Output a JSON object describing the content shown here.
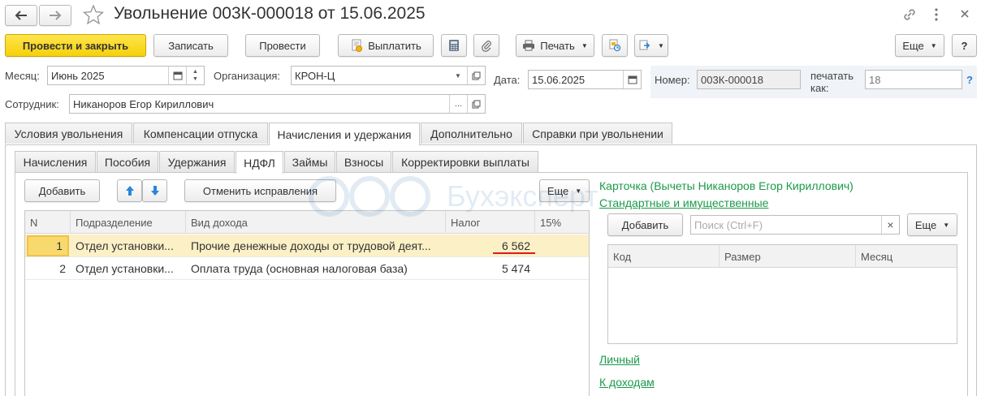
{
  "window": {
    "title": "Увольнение 003К-000018 от 15.06.2025"
  },
  "toolbar": {
    "post_close": "Провести и закрыть",
    "save": "Записать",
    "post": "Провести",
    "pay": "Выплатить",
    "print": "Печать",
    "more": "Еще",
    "help": "?"
  },
  "form": {
    "month_label": "Месяц:",
    "month_value": "Июнь 2025",
    "org_label": "Организация:",
    "org_value": "КРОН-Ц",
    "date_label": "Дата:",
    "date_value": "15.06.2025",
    "number_label": "Номер:",
    "number_value": "003К-000018",
    "print_as_label_1": "печатать",
    "print_as_label_2": "как:",
    "print_as_placeholder": "18",
    "employee_label": "Сотрудник:",
    "employee_value": "Никаноров Егор Кириллович",
    "help_q": "?"
  },
  "tabs": [
    {
      "label": "Условия увольнения"
    },
    {
      "label": "Компенсации отпуска"
    },
    {
      "label": "Начисления и удержания"
    },
    {
      "label": "Дополнительно"
    },
    {
      "label": "Справки при увольнении"
    }
  ],
  "subtabs": [
    {
      "label": "Начисления"
    },
    {
      "label": "Пособия"
    },
    {
      "label": "Удержания"
    },
    {
      "label": "НДФЛ"
    },
    {
      "label": "Займы"
    },
    {
      "label": "Взносы"
    },
    {
      "label": "Корректировки выплаты"
    }
  ],
  "ndfl": {
    "add": "Добавить",
    "cancel_corrections": "Отменить исправления",
    "more": "Еще",
    "columns": [
      "N",
      "Подразделение",
      "Вид дохода",
      "Налог",
      "15%"
    ],
    "rows": [
      {
        "n": "1",
        "dept": "Отдел установки...",
        "income": "Прочие денежные доходы от трудовой деят...",
        "tax": "6 562",
        "p15": ""
      },
      {
        "n": "2",
        "dept": "Отдел установки...",
        "income": "Оплата труда (основная налоговая база)",
        "tax": "5 474",
        "p15": ""
      }
    ]
  },
  "card": {
    "title": "Карточка (Вычеты Никаноров Егор Кириллович)",
    "standard_link": "Стандартные и имущественные",
    "add": "Добавить",
    "search_placeholder": "Поиск (Ctrl+F)",
    "clear": "×",
    "more": "Еще",
    "columns": [
      "Код",
      "Размер",
      "Месяц"
    ],
    "personal_link": "Личный",
    "income_link": "К доходам"
  },
  "watermark": "Бухэксперт",
  "colors": {
    "primary_button": "#f5d10a",
    "link_green": "#1b9a4a",
    "selected_row": "#fbf0c6",
    "underline_red": "#e0191c"
  }
}
